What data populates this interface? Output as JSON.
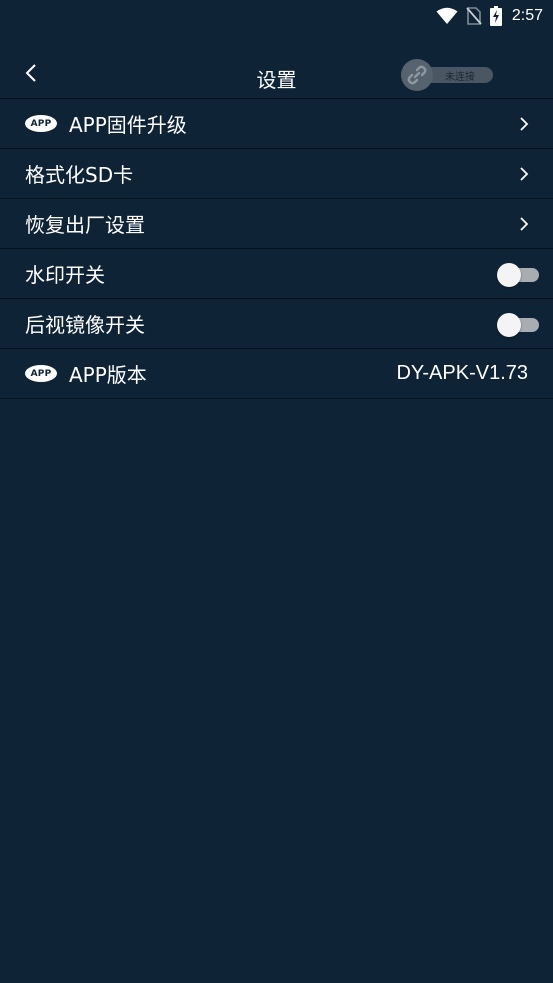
{
  "status_bar": {
    "time": "2:57",
    "icons": [
      "wifi-icon",
      "no-sim-icon",
      "battery-charging-icon"
    ]
  },
  "header": {
    "title": "设置",
    "back_icon": "chevron-left-icon",
    "connection_status": "未连接",
    "connection_icon": "link-icon"
  },
  "badge_text": "APP",
  "settings": {
    "firmware_upgrade": {
      "label": "APP固件升级"
    },
    "format_sd": {
      "label": "格式化SD卡"
    },
    "factory_reset": {
      "label": "恢复出厂设置"
    },
    "watermark": {
      "label": "水印开关",
      "enabled": false
    },
    "rear_mirror": {
      "label": "后视镜像开关",
      "enabled": false
    },
    "app_version": {
      "label": "APP版本",
      "value": "DY-APK-V1.73"
    }
  },
  "colors": {
    "background": "#0f2337",
    "divider": "#060f19",
    "toggle_off_track": "#a8adb2"
  }
}
